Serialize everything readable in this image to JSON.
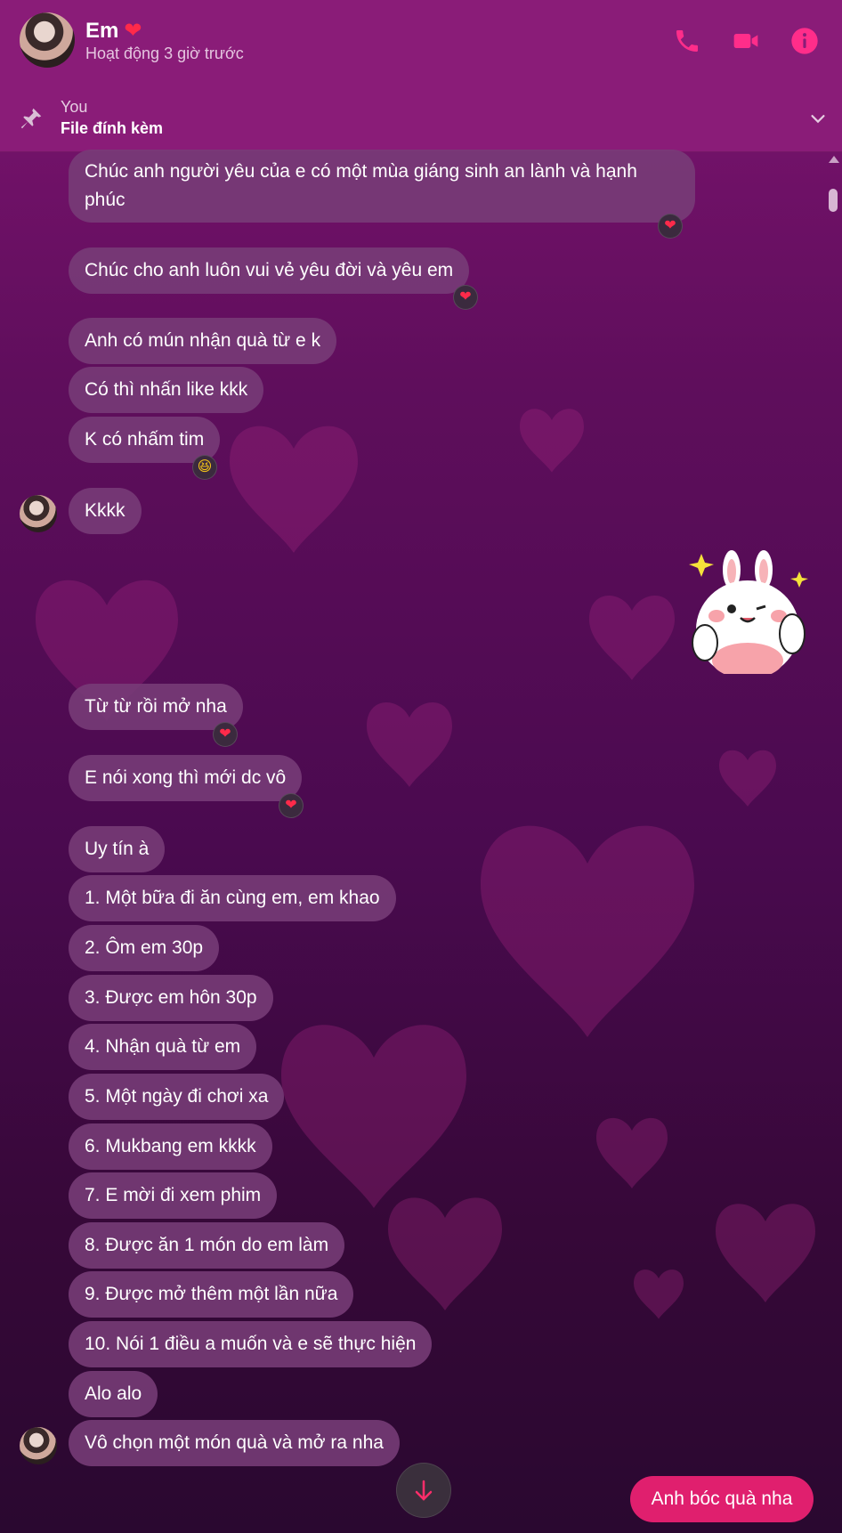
{
  "header": {
    "contact_name": "Em",
    "name_emoji": "❤",
    "status": "Hoạt động 3 giờ trước"
  },
  "pinned": {
    "author": "You",
    "message": "File đính kèm"
  },
  "messages": [
    {
      "text": "Chúc anh người yêu của e có một mùa giáng sinh an lành và hạnh phúc",
      "reaction": "❤"
    },
    {
      "text": "Chúc cho anh luôn vui vẻ yêu đời và yêu em",
      "reaction": "❤"
    },
    {
      "text": "Anh có mún nhận quà từ e k"
    },
    {
      "text": "Có thì nhấn like kkk"
    },
    {
      "text": "K có nhấm tim",
      "reaction": "😆"
    },
    {
      "text": "Kkkk"
    },
    {
      "text": "Từ từ rồi mở nha",
      "reaction": "❤"
    },
    {
      "text": "E nói xong thì mới dc vô",
      "reaction": "❤"
    },
    {
      "text": "Uy tín à"
    },
    {
      "text": "1. Một bữa đi ăn cùng em, em khao"
    },
    {
      "text": "2. Ôm em 30p"
    },
    {
      "text": "3. Được em hôn 30p"
    },
    {
      "text": "4. Nhận quà từ em"
    },
    {
      "text": "5. Một ngày đi chơi xa"
    },
    {
      "text": "6. Mukbang em kkkk"
    },
    {
      "text": "7. E mời đi xem phim"
    },
    {
      "text": "8. Được ăn 1 món do em làm"
    },
    {
      "text": "9. Được mở thêm một lần nữa"
    },
    {
      "text": "10. Nói 1 điều a muốn và e sẽ thực hiện"
    },
    {
      "text": "Alo alo"
    },
    {
      "text": "Vô chọn một món quà và mở ra nha"
    }
  ],
  "outgoing": {
    "reply_text": "Anh bóc quà nha"
  },
  "colors": {
    "accent": "#ff2d8a",
    "header_bg": "#8a1c78",
    "reply_bubble": "#e01f6e"
  },
  "icons": [
    "phone-icon",
    "video-call-icon",
    "info-icon",
    "pin-icon",
    "chevron-down-icon",
    "arrow-down-icon"
  ]
}
